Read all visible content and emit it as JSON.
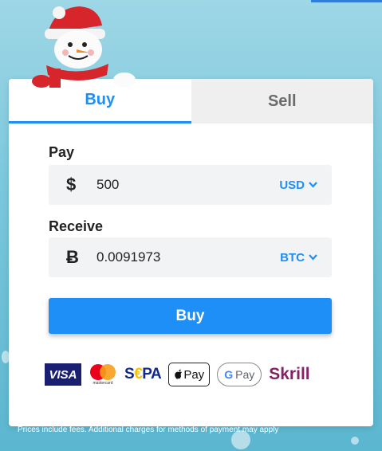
{
  "tabs": {
    "buy": "Buy",
    "sell": "Sell"
  },
  "pay": {
    "label": "Pay",
    "symbol": "$",
    "amount": "500",
    "currency": "USD"
  },
  "receive": {
    "label": "Receive",
    "symbol": "Ƀ",
    "amount": "0.0091973",
    "currency": "BTC"
  },
  "buy_button": "Buy",
  "payment_methods": {
    "visa": "VISA",
    "mastercard": "mastercard",
    "sepa_s": "S",
    "sepa_e": "€",
    "sepa_pa": "PA",
    "apple_pay": "Pay",
    "google_pay": "Pay",
    "google_g": "G",
    "skrill": "Skrill"
  },
  "footnote": "Prices include fees. Additional charges for methods of payment may apply",
  "colors": {
    "accent": "#1e8ff6",
    "skrill": "#862165",
    "visa": "#1a1f71",
    "sepa": "#10298e"
  }
}
